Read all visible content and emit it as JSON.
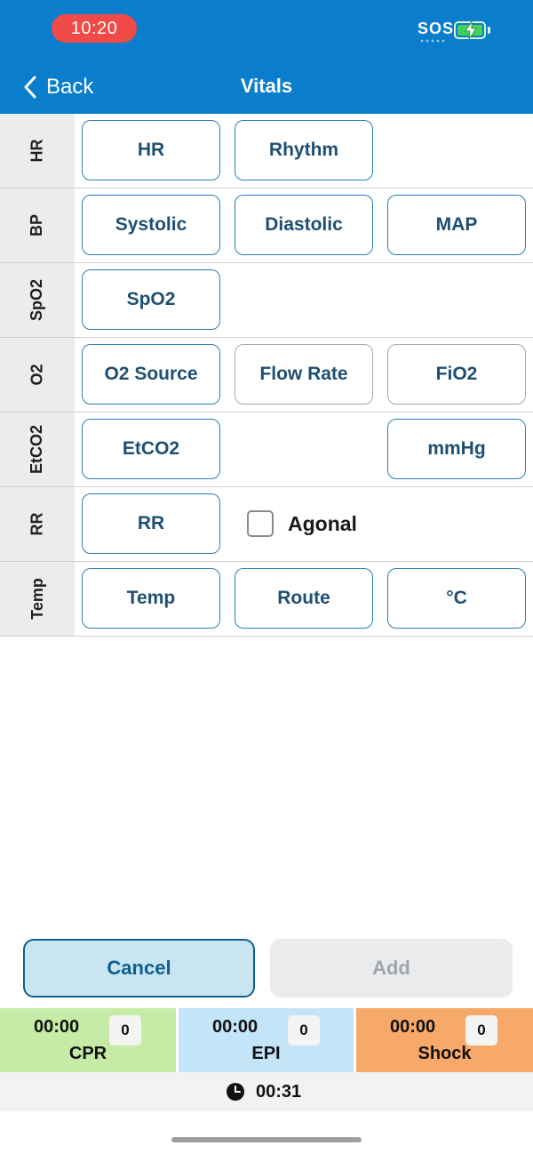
{
  "status_bar": {
    "time": "10:20",
    "sos": "SOS"
  },
  "header": {
    "back_label": "Back",
    "title": "Vitals"
  },
  "rows": {
    "hr": {
      "label": "HR",
      "fields": [
        "HR",
        "Rhythm"
      ]
    },
    "bp": {
      "label": "BP",
      "fields": [
        "Systolic",
        "Diastolic",
        "MAP"
      ]
    },
    "spo2": {
      "label": "SpO2",
      "fields": [
        "SpO2"
      ]
    },
    "o2": {
      "label": "O2",
      "fields": [
        "O2 Source",
        "Flow Rate",
        "FiO2"
      ]
    },
    "etco2": {
      "label": "EtCO2",
      "fields": [
        "EtCO2",
        "mmHg"
      ]
    },
    "rr": {
      "label": "RR",
      "fields": [
        "RR"
      ],
      "checkbox_label": "Agonal",
      "checkbox_checked": false
    },
    "temp": {
      "label": "Temp",
      "fields": [
        "Temp",
        "Route",
        "°C"
      ]
    }
  },
  "actions": {
    "cancel": "Cancel",
    "add": "Add"
  },
  "timers": [
    {
      "time": "00:00",
      "count": "0",
      "name": "CPR",
      "color": "#c6eba6"
    },
    {
      "time": "00:00",
      "count": "0",
      "name": "EPI",
      "color": "#c4e4f7"
    },
    {
      "time": "00:00",
      "count": "0",
      "name": "Shock",
      "color": "#f7a96a"
    }
  ],
  "elapsed": "00:31",
  "colors": {
    "header": "#0a7dcc",
    "accent": "#1e4f72",
    "field_border": "#2b7fb3",
    "status_pill": "#ef4a47"
  }
}
